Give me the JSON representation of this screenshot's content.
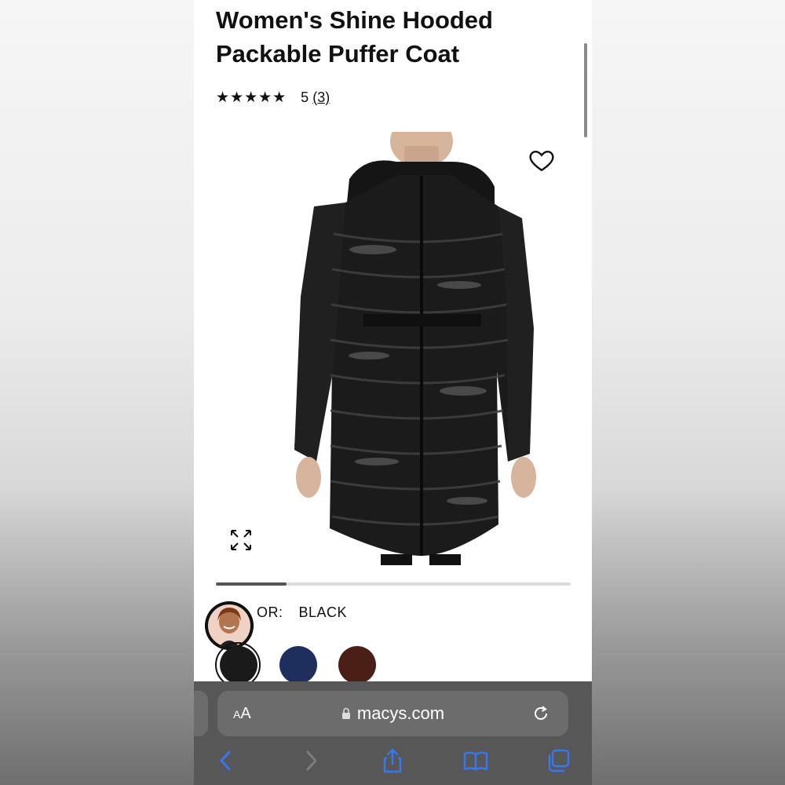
{
  "product": {
    "title_line1": "Women's Shine Hooded",
    "title_line2": "Packable Puffer Coat",
    "stars": "★★★★★",
    "rating_value": "5",
    "rating_count": "(3)",
    "rating_numeric": 5
  },
  "gallery": {
    "image_alt": "Black shiny hooded puffer coat",
    "progress_fraction": 0.2
  },
  "color": {
    "label": "OR:",
    "selected": "BLACK",
    "swatches": [
      {
        "name": "black",
        "color": "#1a1a1a"
      },
      {
        "name": "navy",
        "color": "#1e2f5e"
      },
      {
        "name": "brown",
        "color": "#4a1f16"
      }
    ]
  },
  "browser": {
    "aa_label_small": "A",
    "aa_label_large": "A",
    "url": "macys.com",
    "icons": [
      "back-icon",
      "forward-icon",
      "share-icon",
      "bookmarks-icon",
      "tabs-icon",
      "reload-icon",
      "lock-icon"
    ],
    "accent": "#3478f6"
  }
}
